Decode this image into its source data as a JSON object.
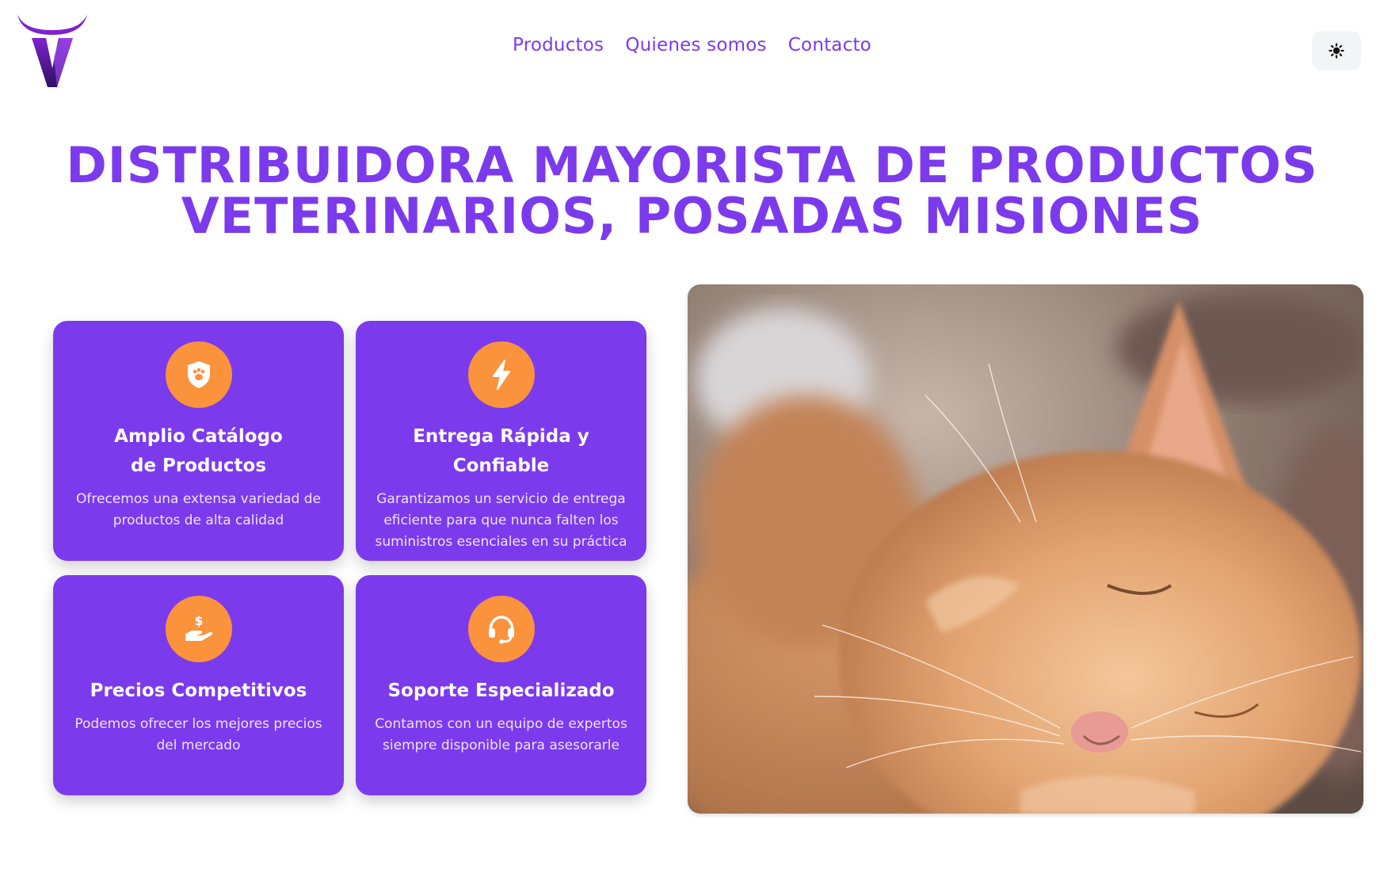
{
  "header": {
    "logo_icon": "bull-v-logo",
    "nav": [
      "Productos",
      "Quienes somos",
      "Contacto"
    ],
    "theme_toggle_icon": "sun-icon"
  },
  "hero": {
    "title_line1": "DISTRIBUIDORA MAYORISTA DE PRODUCTOS",
    "title_line2": "VETERINARIOS, POSADAS MISIONES"
  },
  "features": [
    {
      "icon": "shield-paw-icon",
      "title_line1": "Amplio Catálogo",
      "title_line2": "de Productos",
      "text": "Ofrecemos una extensa variedad de productos de alta calidad"
    },
    {
      "icon": "lightning-icon",
      "title_line1": "Entrega Rápida y Confiable",
      "text": "Garantizamos un servicio de entrega eficiente para que nunca falten los suministros esenciales en su práctica"
    },
    {
      "icon": "hand-coin-icon",
      "title_line1": "Precios Competitivos",
      "text": "Podemos ofrecer los mejores precios del mercado"
    },
    {
      "icon": "headset-icon",
      "title_line1": "Soporte Especializado",
      "text": "Contamos con un equipo de expertos siempre disponible para asesorarle"
    }
  ],
  "colors": {
    "accent": "#7c3aed",
    "icon_bg": "#fb923c",
    "button_bg": "#f3f4f6"
  }
}
